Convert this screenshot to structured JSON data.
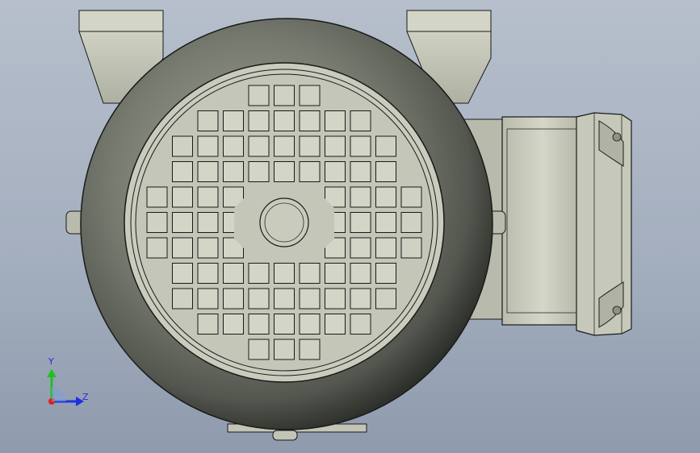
{
  "viewport": {
    "background_top": "#b6bfcb",
    "background_bottom": "#8f9bad"
  },
  "model": {
    "body_color": "#6e7268",
    "part_color": "#c9cbbd",
    "edge_color": "#1a1a1a"
  },
  "triad": {
    "y_label": "Y",
    "z_label": "Z",
    "y_color": "#20c020",
    "z_color": "#2030e0",
    "x_color": "#e02020"
  }
}
